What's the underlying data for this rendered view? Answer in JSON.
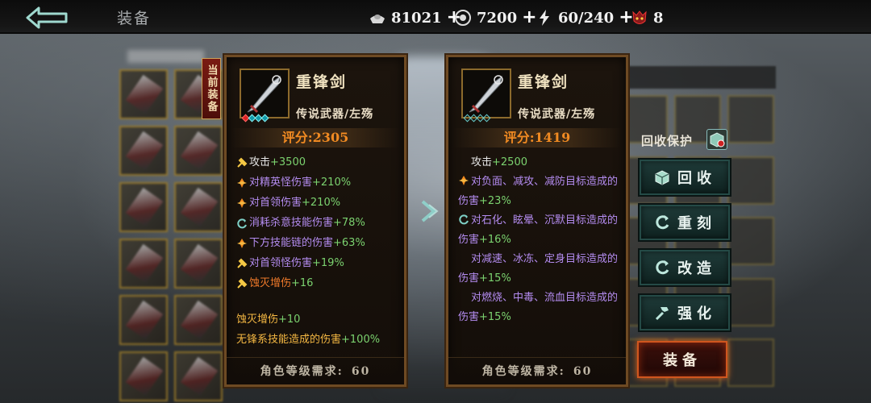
{
  "header": {
    "title": "装备",
    "resources": [
      {
        "icon": "silver-ingot-icon",
        "value": "81021"
      },
      {
        "icon": "coin-icon",
        "value": "7200"
      },
      {
        "icon": "lightning-icon",
        "value": "60/240"
      },
      {
        "icon": "demon-mask-icon",
        "value": "8"
      }
    ]
  },
  "current_tag": "当前装备",
  "left_panel": {
    "name": "重锋剑",
    "type": "传说武器/左殇",
    "score": "评分:2305",
    "attrs": [
      {
        "icon": "hammer-icon",
        "name": "攻击",
        "value": "+3500",
        "color": "white"
      },
      {
        "icon": "flame-icon",
        "name": "对精英怪伤害",
        "value": "+210%",
        "color": "purple"
      },
      {
        "icon": "flame-icon",
        "name": "对首领伤害",
        "value": "+210%",
        "color": "purple"
      },
      {
        "icon": "cycle-icon",
        "name": "消耗杀意技能伤害",
        "value": "+78%",
        "color": "purple"
      },
      {
        "icon": "flame-icon",
        "name": "下方技能链的伤害",
        "value": "+63%",
        "color": "purple"
      },
      {
        "icon": "hammer-icon",
        "name": "对首领怪伤害",
        "value": "+19%",
        "color": "purple"
      },
      {
        "icon": "hammer-icon",
        "name": "蚀灭增伤",
        "value": "+16",
        "color": "orange"
      }
    ],
    "extra1_name": "蚀灭增伤",
    "extra1_value": "+10",
    "extra2_name": "无锋系技能造成的伤害",
    "extra2_value": "+100%",
    "requirement_label": "角色等级需求:",
    "requirement_value": "60"
  },
  "right_panel": {
    "name": "重锋剑",
    "type": "传说武器/左殇",
    "score": "评分:1419",
    "attack_name": "攻击",
    "attack_value": "+2500",
    "attrs_wrap": [
      {
        "icon": "flame-icon",
        "name": "对负面、减攻、减防目标造成的伤害",
        "value": "+23%"
      },
      {
        "icon": "cycle-icon",
        "name": "对石化、眩晕、沉默目标造成的伤害",
        "value": "+16%"
      },
      {
        "icon": "",
        "name": "对减速、冰冻、定身目标造成的伤害",
        "value": "+15%"
      },
      {
        "icon": "",
        "name": "对燃烧、中毒、流血目标造成的伤害",
        "value": "+15%"
      }
    ],
    "requirement_label": "角色等级需求:",
    "requirement_value": "60"
  },
  "actions": {
    "recycle_protect": "回收保护",
    "recycle": "回收",
    "reforge": "重刻",
    "modify": "改造",
    "enhance": "强化",
    "equip": "装备"
  },
  "colors": {
    "score": "#f08a22",
    "value_green": "#7bd26f",
    "purple": "#b48cf0",
    "gold_border": "#9a7a28"
  }
}
